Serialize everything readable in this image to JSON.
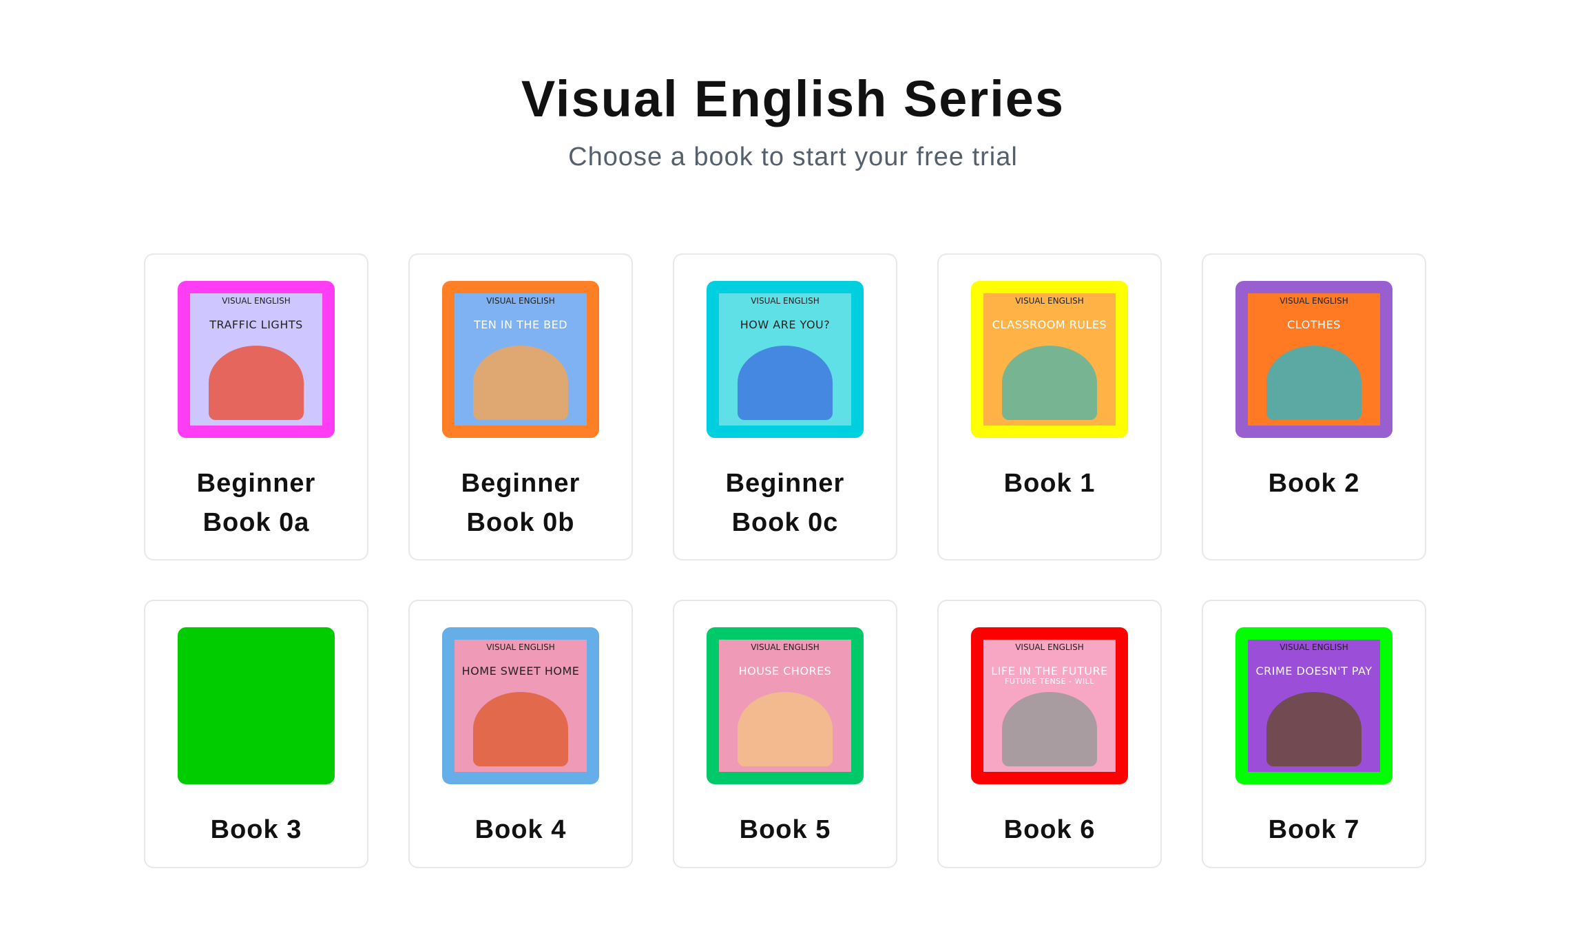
{
  "header": {
    "title": "Visual English Series",
    "subtitle": "Choose a book to start your free trial"
  },
  "books": [
    {
      "line1": "Beginner",
      "line2": "Book 0a",
      "frame_color": "#ff3df5",
      "inner_color": "#cdc6ff",
      "cover_logo": "VISUAL ENGLISH",
      "cover_title": "TRAFFIC LIGHTS",
      "cover_title_color": "#222222",
      "art_color": "#e8553f",
      "icon": "traffic-lights-cover-icon"
    },
    {
      "line1": "Beginner",
      "line2": "Book 0b",
      "frame_color": "#ff7f27",
      "inner_color": "#7fb2f2",
      "cover_logo": "VISUAL ENGLISH",
      "cover_title": "TEN IN THE BED",
      "cover_title_color": "#ffffff",
      "art_color": "#f0a55a",
      "icon": "teddy-bears-cover-icon"
    },
    {
      "line1": "Beginner",
      "line2": "Book 0c",
      "frame_color": "#00cfe0",
      "inner_color": "#5ee0e6",
      "cover_logo": "VISUAL ENGLISH",
      "cover_title": "HOW ARE YOU?",
      "cover_title_color": "#222222",
      "art_color": "#3f78e0",
      "icon": "emotion-face-cover-icon"
    },
    {
      "line1": "Book 1",
      "line2": "",
      "frame_color": "#ffff00",
      "inner_color": "#ffb347",
      "cover_logo": "VISUAL ENGLISH",
      "cover_title": "CLASSROOM RULES",
      "cover_title_color": "#ffffff",
      "art_color": "#5fb5a0",
      "icon": "classroom-cover-icon"
    },
    {
      "line1": "Book 2",
      "line2": "",
      "frame_color": "#9a5fcf",
      "inner_color": "#ff7a22",
      "cover_logo": "VISUAL ENGLISH",
      "cover_title": "CLOTHES",
      "cover_title_color": "#ffffff",
      "art_color": "#3fb0b8",
      "icon": "clothes-cover-icon"
    },
    {
      "line1": "Book 3",
      "line2": "",
      "frame_color": "#00cc00",
      "inner_color": "#00cc00",
      "cover_logo": "",
      "cover_title": "",
      "cover_title_color": "#ffffff",
      "art_color": "#00cc00",
      "icon": "blank-cover-icon"
    },
    {
      "line1": "Book 4",
      "line2": "",
      "frame_color": "#66aee8",
      "inner_color": "#ef9ab7",
      "cover_logo": "VISUAL ENGLISH",
      "cover_title": "HOME SWEET HOME",
      "cover_title_color": "#222222",
      "art_color": "#e0603a",
      "icon": "home-cover-icon"
    },
    {
      "line1": "Book 5",
      "line2": "",
      "frame_color": "#00c96a",
      "inner_color": "#ef9ab7",
      "cover_logo": "VISUAL ENGLISH",
      "cover_title": "HOUSE CHORES",
      "cover_title_color": "#ffffff",
      "art_color": "#f3c08a",
      "icon": "house-chores-cover-icon"
    },
    {
      "line1": "Book 6",
      "line2": "",
      "frame_color": "#ff0000",
      "inner_color": "#f7a6c3",
      "cover_logo": "VISUAL ENGLISH",
      "cover_title": "LIFE IN THE FUTURE",
      "cover_subtitle": "FUTURE TENSE - WILL",
      "cover_title_color": "#ffffff",
      "art_color": "#9a9a9a",
      "icon": "future-robot-cover-icon"
    },
    {
      "line1": "Book 7",
      "line2": "",
      "frame_color": "#00ff00",
      "inner_color": "#9b4fd8",
      "cover_logo": "VISUAL ENGLISH",
      "cover_title": "CRIME DOESN'T PAY",
      "cover_title_color": "#ffffff",
      "art_color": "#6a4a3a",
      "icon": "crime-cover-icon"
    }
  ]
}
